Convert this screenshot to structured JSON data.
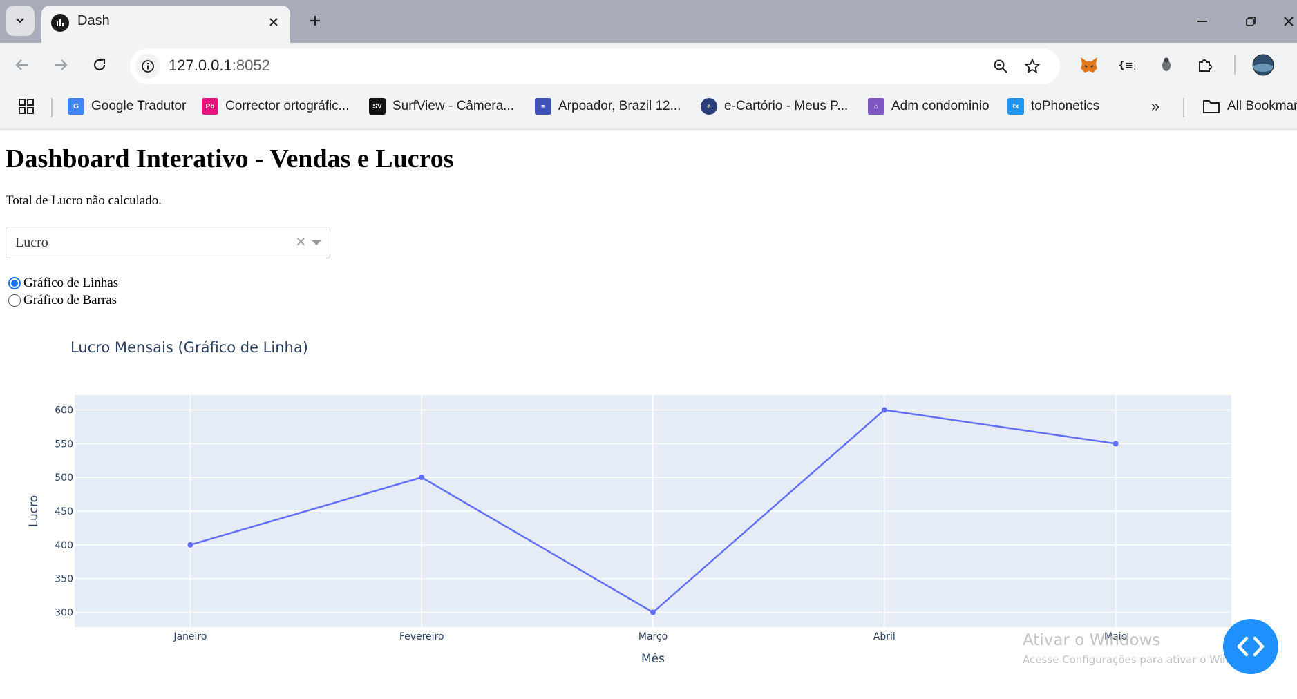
{
  "browser": {
    "tab_title": "Dash",
    "url_host": "127.0.0.1",
    "url_port": ":8052",
    "bookmarks": [
      {
        "label": "Google Tradutor",
        "color": "#4285f4"
      },
      {
        "label": "Corrector ortográfic...",
        "color": "#e8127c"
      },
      {
        "label": "SurfView - Câmera...",
        "color": "#111111"
      },
      {
        "label": "Arpoador, Brazil 12...",
        "color": "#3f51b5"
      },
      {
        "label": "e-Cartório - Meus P...",
        "color": "#2a3f7a"
      },
      {
        "label": "Adm condominio",
        "color": "#7e57c2"
      },
      {
        "label": "toPhonetics",
        "color": "#2196f3"
      }
    ],
    "all_bookmarks": "All Bookmar"
  },
  "page": {
    "title": "Dashboard Interativo - Vendas e Lucros",
    "total_text": "Total de Lucro não calculado.",
    "dropdown_value": "Lucro",
    "radio_options": [
      {
        "label": "Gráfico de Linhas",
        "checked": true
      },
      {
        "label": "Gráfico de Barras",
        "checked": false
      }
    ]
  },
  "chart_data": {
    "type": "line",
    "title": "Lucro Mensais (Gráfico de Linha)",
    "xlabel": "Mês",
    "ylabel": "Lucro",
    "categories": [
      "Janeiro",
      "Fevereiro",
      "Março",
      "Abril",
      "Maio"
    ],
    "values": [
      400,
      500,
      300,
      600,
      550
    ],
    "ylim": [
      278,
      622
    ],
    "yticks": [
      300,
      350,
      400,
      450,
      500,
      550,
      600
    ],
    "line_color": "#636efa",
    "plot_bg": "#e5ecf6",
    "grid": true
  },
  "windows_watermark": {
    "title": "Ativar o Windows",
    "subtitle": "Acesse Configurações para ativar o Windows."
  }
}
